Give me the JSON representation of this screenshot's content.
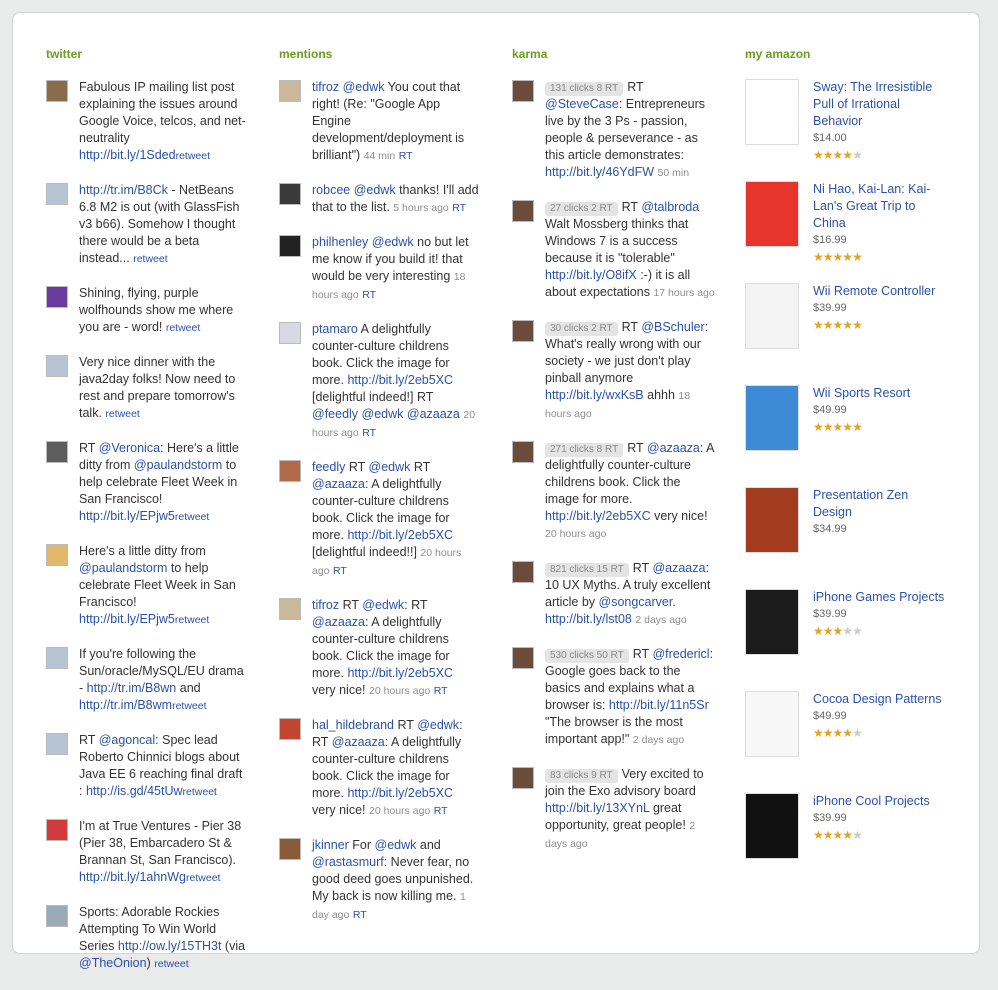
{
  "twitter": {
    "title": "twitter",
    "items": [
      {
        "parts": [
          {
            "t": "Fabulous IP mailing list post explaining the issues around Google Voice, telcos, and net-neutrality "
          },
          {
            "l": "http://bit.ly/1Sded"
          }
        ],
        "rt": "retweet",
        "av": "#8a6b4b"
      },
      {
        "parts": [
          {
            "l": "http://tr.im/B8Ck"
          },
          {
            "t": " - NetBeans 6.8 M2 is out (with GlassFish v3 b66). Somehow I thought there would be a beta instead... "
          }
        ],
        "rt": "retweet",
        "av": "#b7c4d4"
      },
      {
        "parts": [
          {
            "t": "Shining, flying, purple wolfhounds show me where you are - word! "
          }
        ],
        "rt": "retweet",
        "av": "#6b3aa0"
      },
      {
        "parts": [
          {
            "t": "Very nice dinner with the java2day folks! Now need to rest and prepare tomorrow's talk. "
          }
        ],
        "rt": "retweet",
        "av": "#b7c4d4"
      },
      {
        "parts": [
          {
            "t": "RT "
          },
          {
            "l": "@Veronica"
          },
          {
            "t": ": Here's a little ditty from "
          },
          {
            "l": "@paulandstorm"
          },
          {
            "t": " to help celebrate Fleet Week in San Francisco! "
          },
          {
            "l": "http://bit.ly/EPjw5"
          }
        ],
        "rt": "retweet",
        "av": "#5d5d5d"
      },
      {
        "parts": [
          {
            "t": "Here's a little ditty from "
          },
          {
            "l": "@paulandstorm"
          },
          {
            "t": " to help celebrate Fleet Week in San Francisco! "
          },
          {
            "l": "http://bit.ly/EPjw5"
          }
        ],
        "rt": "retweet",
        "av": "#e2b86a"
      },
      {
        "parts": [
          {
            "t": "If you're following the Sun/oracle/MySQL/EU drama - "
          },
          {
            "l": "http://tr.im/B8wn"
          },
          {
            "t": " and "
          },
          {
            "l": "http://tr.im/B8wm"
          }
        ],
        "rt": "retweet",
        "av": "#b7c4d4"
      },
      {
        "parts": [
          {
            "t": "RT "
          },
          {
            "l": "@agoncal"
          },
          {
            "t": ": Spec lead Roberto Chinnici blogs about Java EE 6 reaching final draft : "
          },
          {
            "l": "http://is.gd/45tUw"
          }
        ],
        "rt": "retweet",
        "av": "#b7c4d4"
      },
      {
        "parts": [
          {
            "t": "I'm at True Ventures - Pier 38 (Pier 38, Embarcadero St & Brannan St, San Francisco). "
          },
          {
            "l": "http://bit.ly/1ahnWg"
          }
        ],
        "rt": "retweet",
        "av": "#d23b3b"
      },
      {
        "parts": [
          {
            "t": "Sports: Adorable Rockies Attempting To Win World Series "
          },
          {
            "l": "http://ow.ly/15TH3t"
          },
          {
            "t": " (via "
          },
          {
            "l": "@TheOnion"
          },
          {
            "t": ") "
          }
        ],
        "rt": "retweet",
        "av": "#9aaab6"
      }
    ]
  },
  "mentions": {
    "title": "mentions",
    "items": [
      {
        "parts": [
          {
            "l": "tifroz"
          },
          {
            "t": " "
          },
          {
            "l": "@edwk"
          },
          {
            "t": " You cout that right! (Re: \"Google App Engine development/deployment is brilliant\") "
          }
        ],
        "meta": "44 min",
        "rt": "RT",
        "av": "#c9b99a"
      },
      {
        "parts": [
          {
            "l": "robcee"
          },
          {
            "t": " "
          },
          {
            "l": "@edwk"
          },
          {
            "t": " thanks! I'll add that to the list. "
          }
        ],
        "meta": "5 hours ago",
        "rt": "RT",
        "av": "#3a3a3a"
      },
      {
        "parts": [
          {
            "l": "philhenley"
          },
          {
            "t": " "
          },
          {
            "l": "@edwk"
          },
          {
            "t": " no but let me know if you build it! that would be very interesting"
          }
        ],
        "meta": "18 hours ago",
        "rt": "RT",
        "av": "#222222"
      },
      {
        "parts": [
          {
            "l": "ptamaro"
          },
          {
            "t": " A delightfully counter-culture childrens book. Click the image for more. "
          },
          {
            "l": "http://bit.ly/2eb5XC"
          },
          {
            "t": " [delightful indeed!] RT "
          },
          {
            "l": "@feedly"
          },
          {
            "t": " "
          },
          {
            "l": "@edwk"
          },
          {
            "t": " "
          },
          {
            "l": "@azaaza"
          }
        ],
        "meta": "20 hours ago",
        "rt": "RT",
        "av": "#d9d9e4"
      },
      {
        "parts": [
          {
            "l": "feedly"
          },
          {
            "t": " RT "
          },
          {
            "l": "@edwk"
          },
          {
            "t": " RT "
          },
          {
            "l": "@azaaza"
          },
          {
            "t": ": A delightfully counter-culture childrens book. Click the image for more. "
          },
          {
            "l": "http://bit.ly/2eb5XC"
          },
          {
            "t": " [delightful indeed!!] "
          }
        ],
        "meta": "20 hours ago",
        "rt": "RT",
        "av": "#b06a48"
      },
      {
        "parts": [
          {
            "l": "tifroz"
          },
          {
            "t": " RT "
          },
          {
            "l": "@edwk"
          },
          {
            "t": ": RT "
          },
          {
            "l": "@azaaza"
          },
          {
            "t": ": A delightfully counter-culture childrens book. Click the image for more. "
          },
          {
            "l": "http://bit.ly/2eb5XC"
          },
          {
            "t": " very nice!"
          }
        ],
        "meta": "20 hours ago",
        "rt": "RT",
        "av": "#c9b99a"
      },
      {
        "parts": [
          {
            "l": "hal_hildebrand"
          },
          {
            "t": " RT "
          },
          {
            "l": "@edwk"
          },
          {
            "t": ": RT "
          },
          {
            "l": "@azaaza"
          },
          {
            "t": ": A delightfully counter-culture childrens book. Click the image for more. "
          },
          {
            "l": "http://bit.ly/2eb5XC"
          },
          {
            "t": " very nice!"
          }
        ],
        "meta": "20 hours ago",
        "rt": "RT",
        "av": "#c4452f"
      },
      {
        "parts": [
          {
            "l": "jkinner"
          },
          {
            "t": " For "
          },
          {
            "l": "@edwk"
          },
          {
            "t": " and "
          },
          {
            "l": "@rastasmurf"
          },
          {
            "t": ": Never fear, no good deed goes unpunished. My back is now killing me."
          }
        ],
        "meta": "1 day ago",
        "rt": "RT",
        "av": "#8b5a3a"
      }
    ]
  },
  "karma": {
    "title": "karma",
    "items": [
      {
        "badge": "131 clicks 8 RT",
        "parts": [
          {
            "t": "RT "
          },
          {
            "l": "@SteveCase"
          },
          {
            "t": ": Entrepreneurs live by the 3 Ps - passion, people & perseverance - as this article demonstrates: "
          },
          {
            "l": "http://bit.ly/46YdFW"
          }
        ],
        "meta": "50 min"
      },
      {
        "badge": "27 clicks 2 RT",
        "parts": [
          {
            "t": "RT "
          },
          {
            "l": "@talbroda"
          },
          {
            "t": " Walt Mossberg thinks that Windows 7 is a success because it is \"tolerable\" "
          },
          {
            "l": "http://bit.ly/O8ifX"
          },
          {
            "t": " :-) it is all about expectations"
          }
        ],
        "meta": "17 hours ago"
      },
      {
        "badge": "30 clicks 2 RT",
        "parts": [
          {
            "t": "RT "
          },
          {
            "l": "@BSchuler"
          },
          {
            "t": ": What's really wrong with our society - we just don't play pinball anymore "
          },
          {
            "l": "http://bit.ly/wxKsB"
          },
          {
            "t": " ahhh "
          }
        ],
        "meta": "18 hours ago"
      },
      {
        "badge": "271 clicks 8 RT",
        "parts": [
          {
            "t": "RT "
          },
          {
            "l": "@azaaza"
          },
          {
            "t": ": A delightfully counter-culture childrens book. Click the image for more. "
          },
          {
            "l": "http://bit.ly/2eb5XC"
          },
          {
            "t": " very nice! "
          }
        ],
        "meta": "20 hours ago"
      },
      {
        "badge": "821 clicks 15 RT",
        "parts": [
          {
            "t": "RT "
          },
          {
            "l": "@azaaza"
          },
          {
            "t": ": 10 UX Myths. A truly excellent article by "
          },
          {
            "l": "@songcarver"
          },
          {
            "t": ". "
          },
          {
            "l": "http://bit.ly/lst08"
          },
          {
            "t": " "
          }
        ],
        "meta": "2 days ago"
      },
      {
        "badge": "530 clicks 50 RT",
        "parts": [
          {
            "t": "RT "
          },
          {
            "l": "@fredericl"
          },
          {
            "t": ": Google goes back to the basics and explains what a browser is: "
          },
          {
            "l": "http://bit.ly/11n5Sr"
          },
          {
            "t": " \"The browser is the most important app!\" "
          }
        ],
        "meta": "2 days ago"
      },
      {
        "badge": "83 clicks 9 RT",
        "parts": [
          {
            "t": "Very excited to join the Exo advisory board "
          },
          {
            "l": "http://bit.ly/13XYnL"
          },
          {
            "t": " great opportunity, great people! "
          }
        ],
        "meta": "2 days ago"
      }
    ]
  },
  "amazon": {
    "title": "my amazon",
    "items": [
      {
        "title": "Sway: The Irresistible Pull of Irrational Behavior",
        "price": "$14.00",
        "rating": 4,
        "cover": "#ffffff",
        "h": 66
      },
      {
        "title": "Ni Hao, Kai-Lan: Kai-Lan's Great Trip to China",
        "price": "$16.99",
        "rating": 5,
        "cover": "#e7352d",
        "h": 66
      },
      {
        "title": "Wii Remote Controller",
        "price": "$39.99",
        "rating": 4.5,
        "cover": "#f4f4f4",
        "h": 66
      },
      {
        "title": "Wii Sports Resort",
        "price": "$49.99",
        "rating": 4.5,
        "cover": "#3d8ad6",
        "h": 66
      },
      {
        "title": "Presentation Zen Design",
        "price": "$34.99",
        "rating": null,
        "cover": "#a33b1f",
        "h": 66
      },
      {
        "title": "iPhone Games Projects",
        "price": "$39.99",
        "rating": 3,
        "cover": "#1b1b1b",
        "h": 66
      },
      {
        "title": "Cocoa Design Patterns",
        "price": "$49.99",
        "rating": 4,
        "cover": "#f7f7f7",
        "h": 66
      },
      {
        "title": "iPhone Cool Projects",
        "price": "$39.99",
        "rating": 4,
        "cover": "#111111",
        "h": 66
      }
    ]
  }
}
